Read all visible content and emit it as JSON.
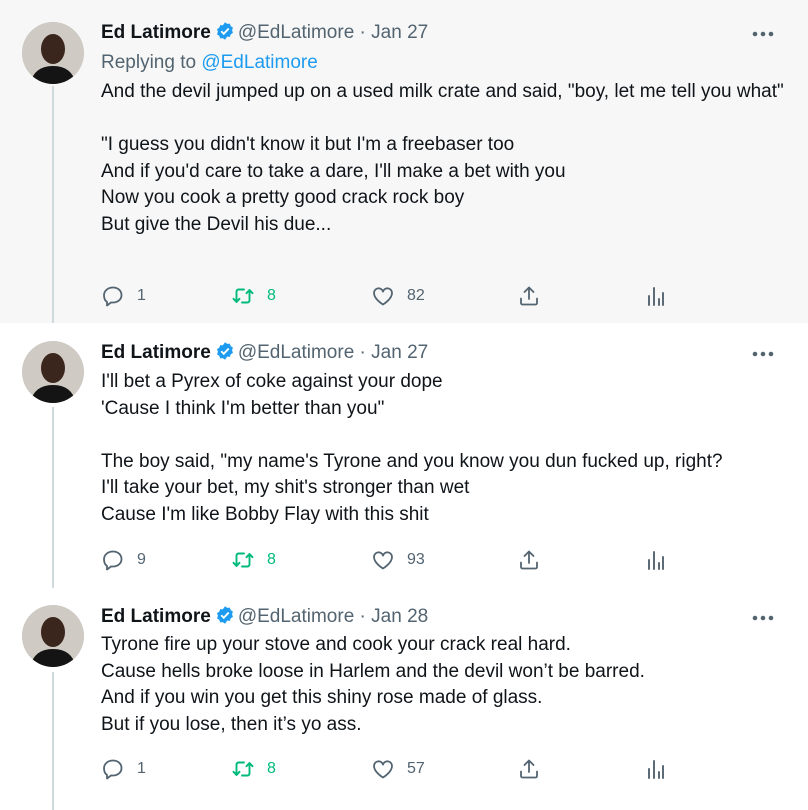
{
  "tweets": [
    {
      "name": "Ed Latimore",
      "handle": "@EdLatimore",
      "dot": "·",
      "date": "Jan 27",
      "replying_label": "Replying to",
      "replying_handle": "@EdLatimore",
      "text": "And the devil jumped up on a used milk crate and said, \"boy, let me tell you what\"\n\n\"I guess you didn't know it but I'm a freebaser too\nAnd if you'd care to take a dare, I'll make a bet with you\nNow you cook a pretty good crack rock boy\nBut give the Devil his due...",
      "replies": "1",
      "retweets": "8",
      "likes": "82"
    },
    {
      "name": "Ed Latimore",
      "handle": "@EdLatimore",
      "dot": "·",
      "date": "Jan 27",
      "text": "I'll bet a Pyrex of coke against your dope\n'Cause I think I'm better than you\"\n\nThe boy said, \"my name's Tyrone and you know you dun fucked up, right?\nI'll take your bet, my shit's stronger than wet\nCause I'm like Bobby Flay with this shit",
      "replies": "9",
      "retweets": "8",
      "likes": "93"
    },
    {
      "name": "Ed Latimore",
      "handle": "@EdLatimore",
      "dot": "·",
      "date": "Jan 28",
      "text": "Tyrone fire up your stove and cook your crack real hard.\nCause hells broke loose in Harlem and the devil won’t be barred.\nAnd if you win you get this shiny rose made of glass.\nBut if you lose, then it’s yo ass.",
      "replies": "1",
      "retweets": "8",
      "likes": "57"
    }
  ],
  "colors": {
    "accent": "#1d9bf0",
    "retweet": "#00ba7c",
    "secondary_text": "#536471",
    "shaded_bg": "#f7f7f7"
  },
  "icons": [
    "verified-badge-icon",
    "more-options-icon",
    "reply-icon",
    "retweet-icon",
    "like-icon",
    "share-icon",
    "analytics-icon"
  ]
}
